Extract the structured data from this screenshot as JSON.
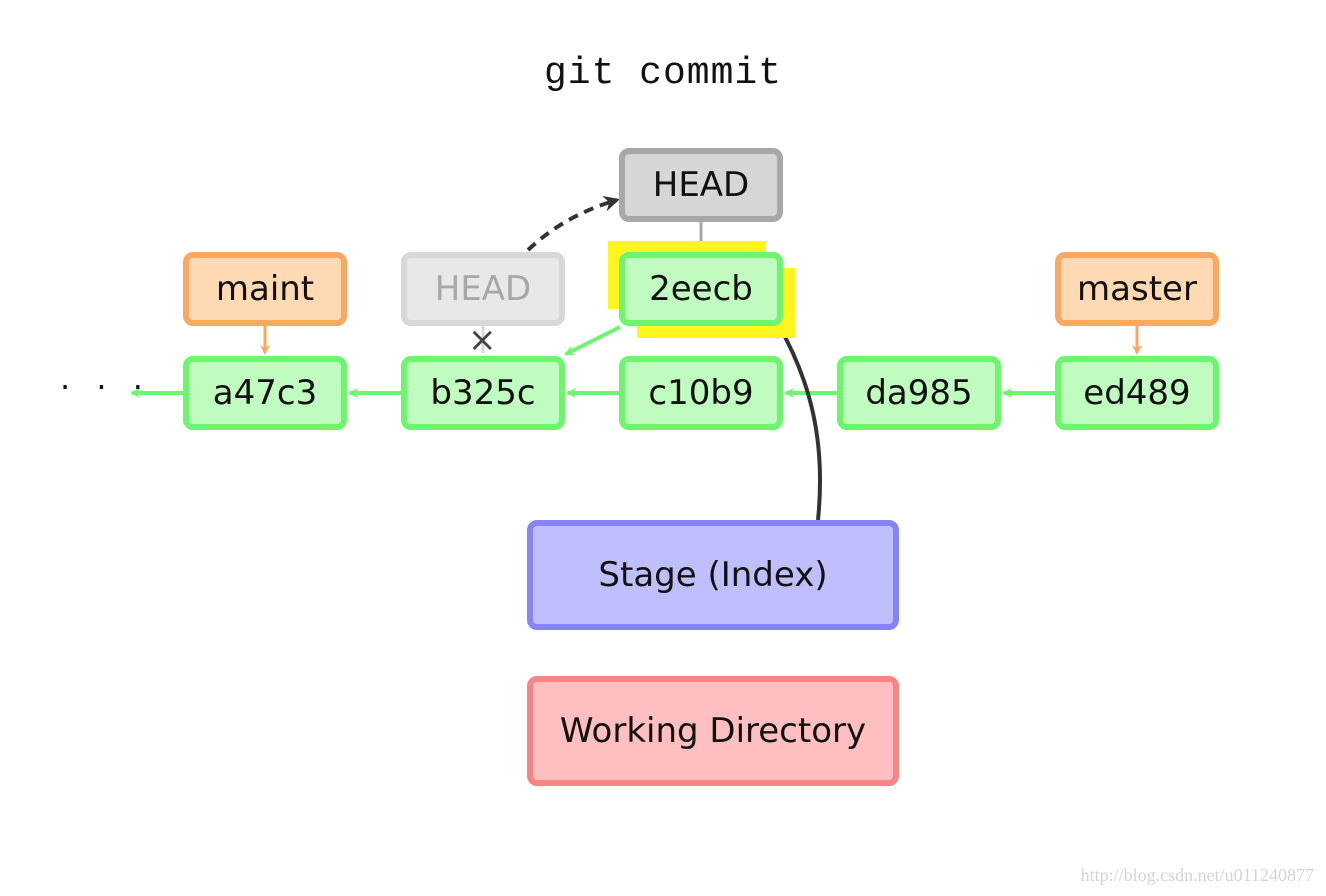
{
  "title": "git commit",
  "ellipsis": "· · ·",
  "commits": [
    {
      "id": "a47c3"
    },
    {
      "id": "b325c"
    },
    {
      "id": "c10b9"
    },
    {
      "id": "da985"
    },
    {
      "id": "ed489"
    },
    {
      "id": "2eecb",
      "highlighted": true
    }
  ],
  "branches": {
    "maint": "maint",
    "master": "master"
  },
  "head": {
    "current": "HEAD",
    "previous": "HEAD",
    "previous_marker": "×"
  },
  "areas": {
    "stage": "Stage (Index)",
    "working_directory": "Working Directory"
  },
  "colors": {
    "commit_fill": "#c0fcc0",
    "commit_border": "#6ef56e",
    "branch_fill": "#ffd9b3",
    "branch_border": "#f8a860",
    "head_fill": "#d6d6d6",
    "head_border": "#a8a8a8",
    "stage_fill": "#bfbffd",
    "stage_border": "#8585f8",
    "wd_fill": "#ffbfc0",
    "wd_border": "#f88486",
    "highlight": "#fff51f"
  },
  "watermark": "http://blog.csdn.net/u011240877"
}
